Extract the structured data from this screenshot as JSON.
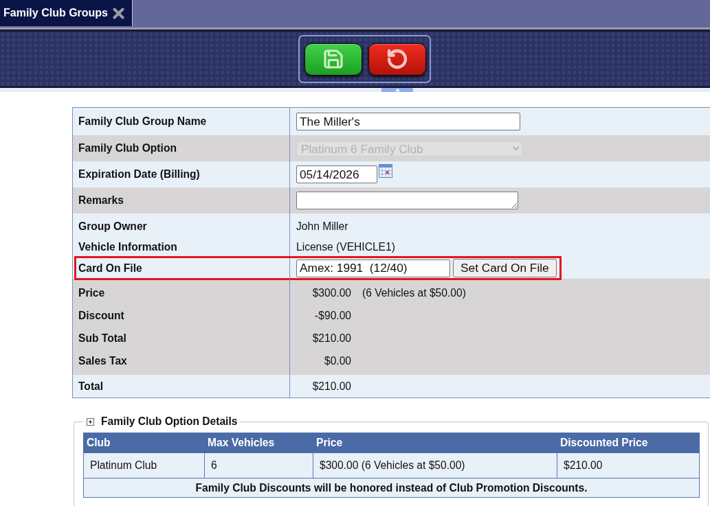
{
  "tabs": [
    {
      "label": "Family Club Groups",
      "selected": true,
      "closable": true
    }
  ],
  "toolbar": {
    "buttons": [
      {
        "kind": "save"
      },
      {
        "kind": "undo"
      }
    ]
  },
  "form": {
    "sections": [
      {
        "rows": [
          {
            "kind": "input",
            "label": "Family Club Group Name",
            "value": "The Miller's"
          }
        ]
      },
      {
        "rows": [
          {
            "kind": "select",
            "label": "Family Club Option",
            "value": "Platinum 6 Family Club",
            "disabled": true
          }
        ]
      },
      {
        "rows": [
          {
            "kind": "date",
            "label": "Expiration Date (Billing)",
            "value": "05/14/2026"
          }
        ]
      },
      {
        "rows": [
          {
            "kind": "textarea",
            "label": "Remarks"
          }
        ]
      },
      {
        "rows": [
          {
            "kind": "text",
            "label": "Group Owner",
            "value": "John Miller"
          },
          {
            "kind": "text",
            "label": "Vehicle Information",
            "value": "License (VEHICLE1)"
          },
          {
            "kind": "card",
            "label": "Card On File",
            "value": "Amex: 1991  (12/40)",
            "button": "Set Card On File",
            "highlighted": true
          }
        ]
      },
      {
        "rows": [
          {
            "kind": "amount",
            "label": "Price",
            "value": "$300.00",
            "note": "(6 Vehicles at $50.00)"
          },
          {
            "kind": "amount",
            "label": "Discount",
            "value": "-$90.00"
          },
          {
            "kind": "amount",
            "label": "Sub Total",
            "value": "$210.00"
          },
          {
            "kind": "amount",
            "label": "Sales Tax",
            "value": "$0.00"
          }
        ]
      },
      {
        "rows": [
          {
            "kind": "amount",
            "label": "Total",
            "value": "$210.00"
          }
        ]
      }
    ]
  },
  "details": {
    "title": "Family Club Option Details",
    "columns": [
      "Club",
      "Max Vehicles",
      "Price",
      "Discounted Price"
    ],
    "rows": [
      [
        "Platinum Club",
        "6",
        "$300.00 (6 Vehicles at $50.00)",
        "$210.00"
      ]
    ],
    "footnote": "Family Club Discounts will be honored instead of Club Promotion Discounts."
  }
}
